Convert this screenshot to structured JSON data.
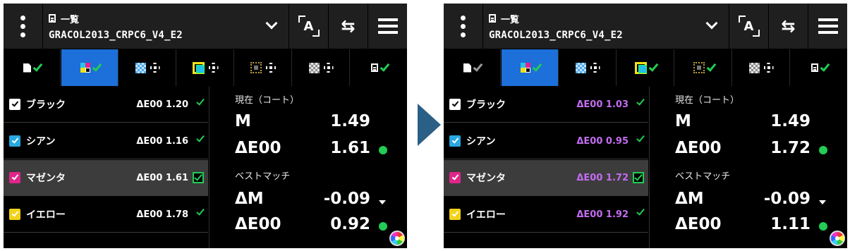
{
  "panels": [
    {
      "header": {
        "list_label": "一覧",
        "profile_name": "GRACOL2013_CRPC6_V4_E2"
      },
      "tabs": [
        {
          "icon": "document-icon",
          "status": "check"
        },
        {
          "icon": "cmyk-icon",
          "status": "check",
          "selected": true
        },
        {
          "icon": "checker-icon",
          "status": "target"
        },
        {
          "icon": "overlap-icon",
          "status": "target"
        },
        {
          "icon": "dotbox-icon",
          "status": "target"
        },
        {
          "icon": "gray-checker-icon",
          "status": "target"
        },
        {
          "icon": "list-icon",
          "status": "check"
        }
      ],
      "rows": [
        {
          "label": "ブラック",
          "value": "ΔE00 1.20",
          "color": "#ffffff"
        },
        {
          "label": "シアン",
          "value": "ΔE00 1.16",
          "color": "#29a8e0"
        },
        {
          "label": "マゼンタ",
          "value": "ΔE00 1.61",
          "color": "#e0258a",
          "selected": true
        },
        {
          "label": "イエロー",
          "value": "ΔE00 1.78",
          "color": "#f2d31a"
        }
      ],
      "detail": {
        "current_label": "現在（コート）",
        "m_key": "M",
        "m_val": "1.49",
        "de_key": "ΔE00",
        "de_val": "1.61",
        "best_label": "ベストマッチ",
        "dm_key": "ΔM",
        "dm_val": "-0.09",
        "de2_key": "ΔE00",
        "de2_val": "0.92"
      }
    },
    {
      "header": {
        "list_label": "一覧",
        "profile_name": "GRACOL2013_CRPC6_V4_E2"
      },
      "tabs": [
        {
          "icon": "document-icon",
          "status": "check-gray"
        },
        {
          "icon": "cmyk-icon",
          "status": "check",
          "selected": true
        },
        {
          "icon": "checker-icon",
          "status": "target"
        },
        {
          "icon": "overlap-icon",
          "status": "check"
        },
        {
          "icon": "dotbox-icon",
          "status": "check"
        },
        {
          "icon": "gray-checker-icon",
          "status": "target"
        },
        {
          "icon": "list-icon",
          "status": "check"
        }
      ],
      "rows": [
        {
          "label": "ブラック",
          "value": "ΔE00 1.03",
          "color": "#ffffff"
        },
        {
          "label": "シアン",
          "value": "ΔE00 0.95",
          "color": "#29a8e0"
        },
        {
          "label": "マゼンタ",
          "value": "ΔE00 1.72",
          "color": "#e0258a",
          "selected": true
        },
        {
          "label": "イエロー",
          "value": "ΔE00 1.92",
          "color": "#f2d31a"
        }
      ],
      "detail": {
        "current_label": "現在（コート）",
        "m_key": "M",
        "m_val": "1.49",
        "de_key": "ΔE00",
        "de_val": "1.72",
        "best_label": "ベストマッチ",
        "dm_key": "ΔM",
        "dm_val": "-0.09",
        "de2_key": "ΔE00",
        "de2_val": "1.11"
      }
    }
  ],
  "colors": {
    "accent_blue": "#1d6fd9",
    "ok_green": "#22cc55",
    "value_purple": "#c36cf0",
    "arrow": "#2a5f86"
  }
}
